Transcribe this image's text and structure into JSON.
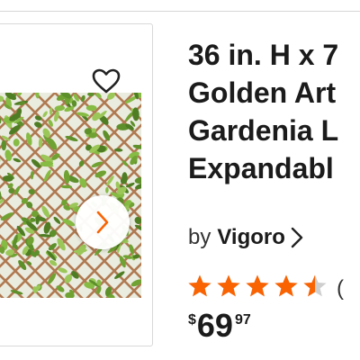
{
  "product": {
    "title": "36 in. H x 7\nGolden Art\nGardenia L\nExpandabl",
    "by_label": "by",
    "brand": "Vigoro",
    "rating": 4.5,
    "reviews_text": "(",
    "price": {
      "currency": "$",
      "dollars": "69",
      "cents": "97"
    }
  },
  "colors": {
    "star": "#f96302",
    "star_empty": "#cfcfcf",
    "leaf": "#7fb23a",
    "lattice": "#b07a52"
  },
  "icons": {
    "favorite": "heart-outline-icon",
    "next": "chevron-right-icon",
    "brand_link": "chevron-right-icon",
    "rating": "star-icon"
  }
}
